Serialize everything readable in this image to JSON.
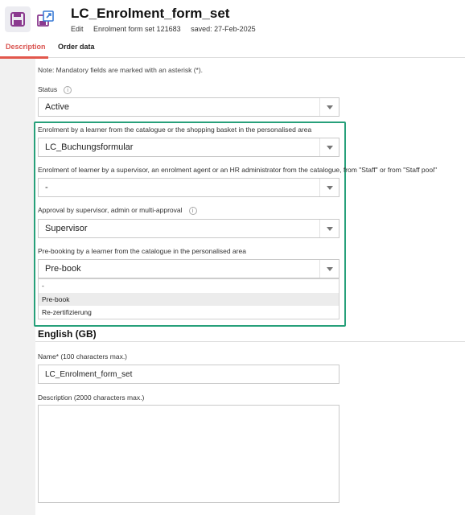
{
  "header": {
    "title": "LC_Enrolment_form_set",
    "mode": "Edit",
    "record": "Enrolment form set 121683",
    "saved": "saved: 27-Feb-2025",
    "save_icon": "save-icon",
    "export_icon": "export-icon"
  },
  "tabs": [
    {
      "label": "Description",
      "active": true
    },
    {
      "label": "Order data",
      "active": false
    }
  ],
  "note": "Note: Mandatory fields are marked with an asterisk (*).",
  "status": {
    "label": "Status",
    "value": "Active"
  },
  "enrol_catalogue": {
    "label": "Enrolment by a learner from the catalogue or the shopping basket in the personalised area",
    "value": "LC_Buchungsformular"
  },
  "enrol_supervisor": {
    "label": "Enrolment of learner by a supervisor, an enrolment agent or an HR administrator from the catalogue, from \"Staff\" or from \"Staff pool\"",
    "value": "-"
  },
  "approval": {
    "label": "Approval by supervisor, admin or multi-approval",
    "value": "Supervisor"
  },
  "prebooking": {
    "label": "Pre-booking by a learner from the catalogue in the personalised area",
    "value": "Pre-book",
    "options": [
      "-",
      "Pre-book",
      "Re-zertifizierung"
    ],
    "selected_index": 1
  },
  "language_section": {
    "title": "English (GB)"
  },
  "name_field": {
    "label": "Name* (100 characters max.)",
    "value": "LC_Enrolment_form_set"
  },
  "description_field": {
    "label": "Description (2000 characters max.)",
    "value": ""
  },
  "colors": {
    "accent": "#e2574c",
    "highlight": "#27a07a",
    "brand_icon": "#8b3a8f"
  }
}
